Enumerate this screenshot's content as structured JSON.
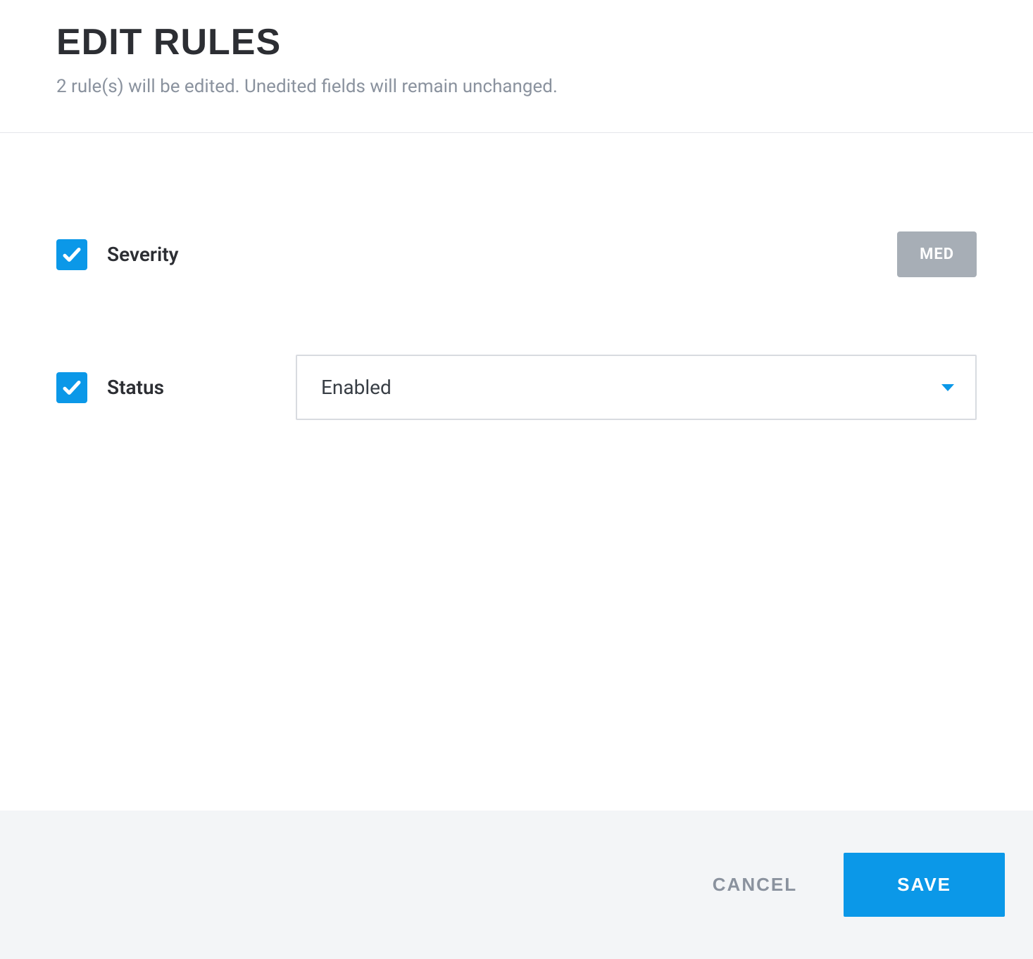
{
  "header": {
    "title": "EDIT RULES",
    "subtitle": "2 rule(s) will be edited. Unedited fields will remain unchanged."
  },
  "fields": {
    "severity": {
      "label": "Severity",
      "checked": true,
      "badge": "MED"
    },
    "status": {
      "label": "Status",
      "checked": true,
      "value": "Enabled"
    }
  },
  "footer": {
    "cancel_label": "CANCEL",
    "save_label": "SAVE"
  },
  "colors": {
    "accent": "#0b98e8",
    "muted": "#8a929e",
    "badge_bg": "#a7aeb6"
  }
}
